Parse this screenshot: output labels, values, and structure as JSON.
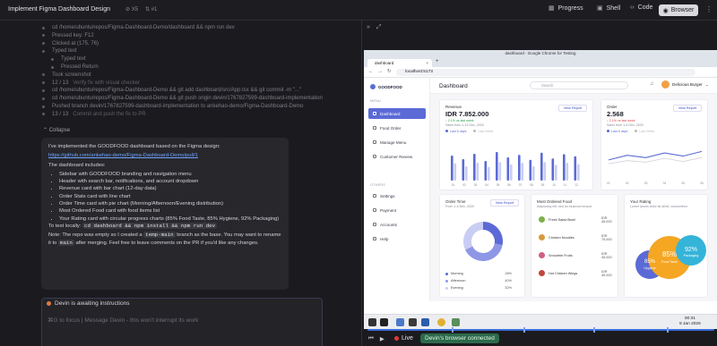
{
  "topbar": {
    "title": "Implement Figma Dashboard Design",
    "meta1": "X5",
    "meta2": "#1",
    "progress": "Progress",
    "shell": "Shell",
    "code": "Code",
    "browser": "Browser"
  },
  "log": [
    {
      "text": "cd /home/ubuntu/repos/Figma-Dashboard-Demo/dashboard && npm run dev",
      "dim": ""
    },
    {
      "text": "Pressed key: F12",
      "dim": ""
    },
    {
      "text": "Clicked at (175, 76)",
      "dim": ""
    },
    {
      "text": "Typed text",
      "dim": ""
    },
    {
      "text": "Typed text",
      "dim": "",
      "sub": true
    },
    {
      "text": "Pressed Return",
      "dim": "",
      "sub": true
    },
    {
      "text": "Took screenshot",
      "dim": ""
    },
    {
      "text": "12 / 13",
      "dim": "Verify fix with visual checker"
    },
    {
      "text": "cd /home/ubuntu/repos/Figma-Dashboard-Demo && git add dashboard/src/App.tsx && git commit -m \"...\"",
      "dim": ""
    },
    {
      "text": "cd /home/ubuntu/repos/Figma-Dashboard-Demo && git push origin devin/1767827599-dashboard-implementation",
      "dim": ""
    },
    {
      "text": "Pushed branch devin/1767827599-dashboard-implementation to ankehao-demo/Figma-Dashboard-Demo",
      "dim": ""
    },
    {
      "text": "13 / 13",
      "dim": "Commit and push the fix to PR"
    }
  ],
  "collapse": "Collapse",
  "message": {
    "intro": "I've implemented the GOODFOOD dashboard based on the Figma design:",
    "link": "https://github.com/ankehao-demo/Figma-Dashboard-Demo/pull/1",
    "includes": "The dashboard includes:",
    "bullets": [
      "Sidebar with GOODFOOD branding and navigation menu",
      "Header with search bar, notifications, and account dropdown",
      "Revenue card with bar chart (12-day data)",
      "Order Stats card with line chart",
      "Order Time card with pie chart (Morning/Afternoon/Evening distribution)",
      "Most Ordered Food card with food items list",
      "Your Rating card with circular progress charts (85% Food Taste, 85% Hygiene, 92% Packaging)"
    ],
    "test_prefix": "To test locally:",
    "test_cmd": "cd dashboard && npm install && npm run dev",
    "note_a": "Note: The repo was empty so I created a",
    "note_code1": "temp-main",
    "note_b": "branch as the base. You may want to rename it to",
    "note_code2": "main",
    "note_c": "after merging. Feel free to leave comments on the PR if you'd like any changes."
  },
  "awaiting": "Devin is awaiting instructions",
  "input_placeholder": "⌘G to focus | Message Devin - this won't interrupt its work",
  "chrome": {
    "window_title": "dashboard - Google Chrome for Testing",
    "tab": "dashboard",
    "url": "localhost:5173"
  },
  "dashboard": {
    "brand": "GOODFOOD",
    "menu_label": "MENU",
    "others_label": "OTHERS",
    "menu": [
      "Dashboard",
      "Food Order",
      "Manage Menu",
      "Customer Review"
    ],
    "others": [
      "Settings",
      "Payment",
      "Accounts",
      "Help"
    ],
    "title": "Dashboard",
    "search_placeholder": "Search",
    "account": "Delicious Burger",
    "revenue": {
      "title": "Revenue",
      "value": "IDR 7.852.000",
      "delta": "↑ 2.1% vs last week",
      "sub": "Sales from 1-12 Dec, 2020",
      "btn": "View Report",
      "legend": [
        "Last 6 days",
        "Last Week"
      ],
      "days": [
        "01",
        "02",
        "03",
        "04",
        "05",
        "06",
        "07",
        "08",
        "09",
        "10",
        "11",
        "12"
      ]
    },
    "order": {
      "title": "Order",
      "value": "2.568",
      "delta": "↓ 2.1% vs last week",
      "sub": "Sales from 1-6 Dec, 2020",
      "btn": "View Report",
      "legend": [
        "Last 6 days",
        "Last Week"
      ],
      "days": [
        "01",
        "02",
        "03",
        "04",
        "05",
        "06"
      ]
    },
    "order_time": {
      "title": "Order Time",
      "sub": "From 1-6 Dec, 2020",
      "btn": "View Report",
      "items": [
        {
          "label": "Morning",
          "value": "28%"
        },
        {
          "label": "Afternoon",
          "value": "40%"
        },
        {
          "label": "Evening",
          "value": "32%"
        }
      ]
    },
    "most_ordered": {
      "title": "Most Ordered Food",
      "sub": "Adipiscing elit, sed do eiusmod tempor",
      "items": [
        {
          "name": "Fresh Salad Bowl",
          "price": "IDR 45.000"
        },
        {
          "name": "Chicken Noodles",
          "price": "IDR 75.000"
        },
        {
          "name": "Smoothie Fruits",
          "price": "IDR 45.000"
        },
        {
          "name": "Hot Chicken Wings",
          "price": "IDR 45.000"
        }
      ]
    },
    "rating": {
      "title": "Your Rating",
      "sub": "Lorem ipsum dolor sit amet, consectetur",
      "items": [
        {
          "pct": "85%",
          "label": "Hygiene"
        },
        {
          "pct": "85%",
          "label": "Food Taste"
        },
        {
          "pct": "92%",
          "label": "Packaging"
        }
      ]
    }
  },
  "taskbar": {
    "time": "00:31",
    "date": "9 Jan 2026"
  },
  "controls": {
    "live": "Live",
    "connected": "Devin's browser connected"
  },
  "chart_data": [
    {
      "type": "bar",
      "categories": [
        "01",
        "02",
        "03",
        "04",
        "05",
        "06",
        "07",
        "08",
        "09",
        "10",
        "11",
        "12"
      ],
      "series": [
        {
          "name": "Last 6 days",
          "values": [
            70,
            60,
            75,
            55,
            80,
            65,
            72,
            58,
            78,
            62,
            74,
            68
          ]
        },
        {
          "name": "Last Week",
          "values": [
            48,
            40,
            50,
            38,
            52,
            45,
            50,
            40,
            52,
            44,
            50,
            46
          ]
        }
      ]
    },
    {
      "type": "line",
      "categories": [
        "01",
        "02",
        "03",
        "04",
        "05",
        "06"
      ],
      "series": [
        {
          "name": "Last 6 days",
          "values": [
            40,
            52,
            46,
            58,
            50,
            62
          ]
        },
        {
          "name": "Last Week",
          "values": [
            30,
            38,
            34,
            44,
            36,
            46
          ]
        }
      ]
    },
    {
      "type": "pie",
      "categories": [
        "Morning",
        "Afternoon",
        "Evening"
      ],
      "values": [
        28,
        40,
        32
      ]
    }
  ],
  "colors": {
    "accent": "#5b6ad6",
    "bar_light": "#c9cdf3",
    "live": "#e53935"
  }
}
